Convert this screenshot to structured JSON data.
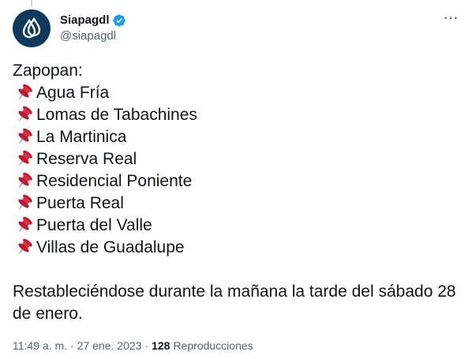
{
  "author": {
    "display_name": "Siapagdl",
    "handle": "@siapagdl",
    "verified_icon": "verified-badge-icon",
    "avatar_icon": "siapa-drops-logo",
    "colors": {
      "avatar_bg": "#0d3a5c",
      "verified": "#1d9bf0"
    }
  },
  "menu": {
    "more_icon": "more-horizontal-icon",
    "more_label": "···"
  },
  "tweet": {
    "intro": "Zapopan:",
    "pin_icon": "pushpin-icon",
    "locations": [
      "Agua Fría",
      "Lomas de Tabachines",
      "La Martinica",
      "Reserva Real",
      "Residencial Poniente",
      "Puerta Real",
      "Puerta del Valle",
      "Villas de Guadalupe"
    ],
    "closing": "Restableciéndose durante la mañana la tarde del sábado 28 de enero."
  },
  "meta": {
    "time": "11:49 a. m.",
    "separator": "·",
    "date": "27 ene. 2023",
    "views_count": "128",
    "views_label": "Reproducciones"
  }
}
